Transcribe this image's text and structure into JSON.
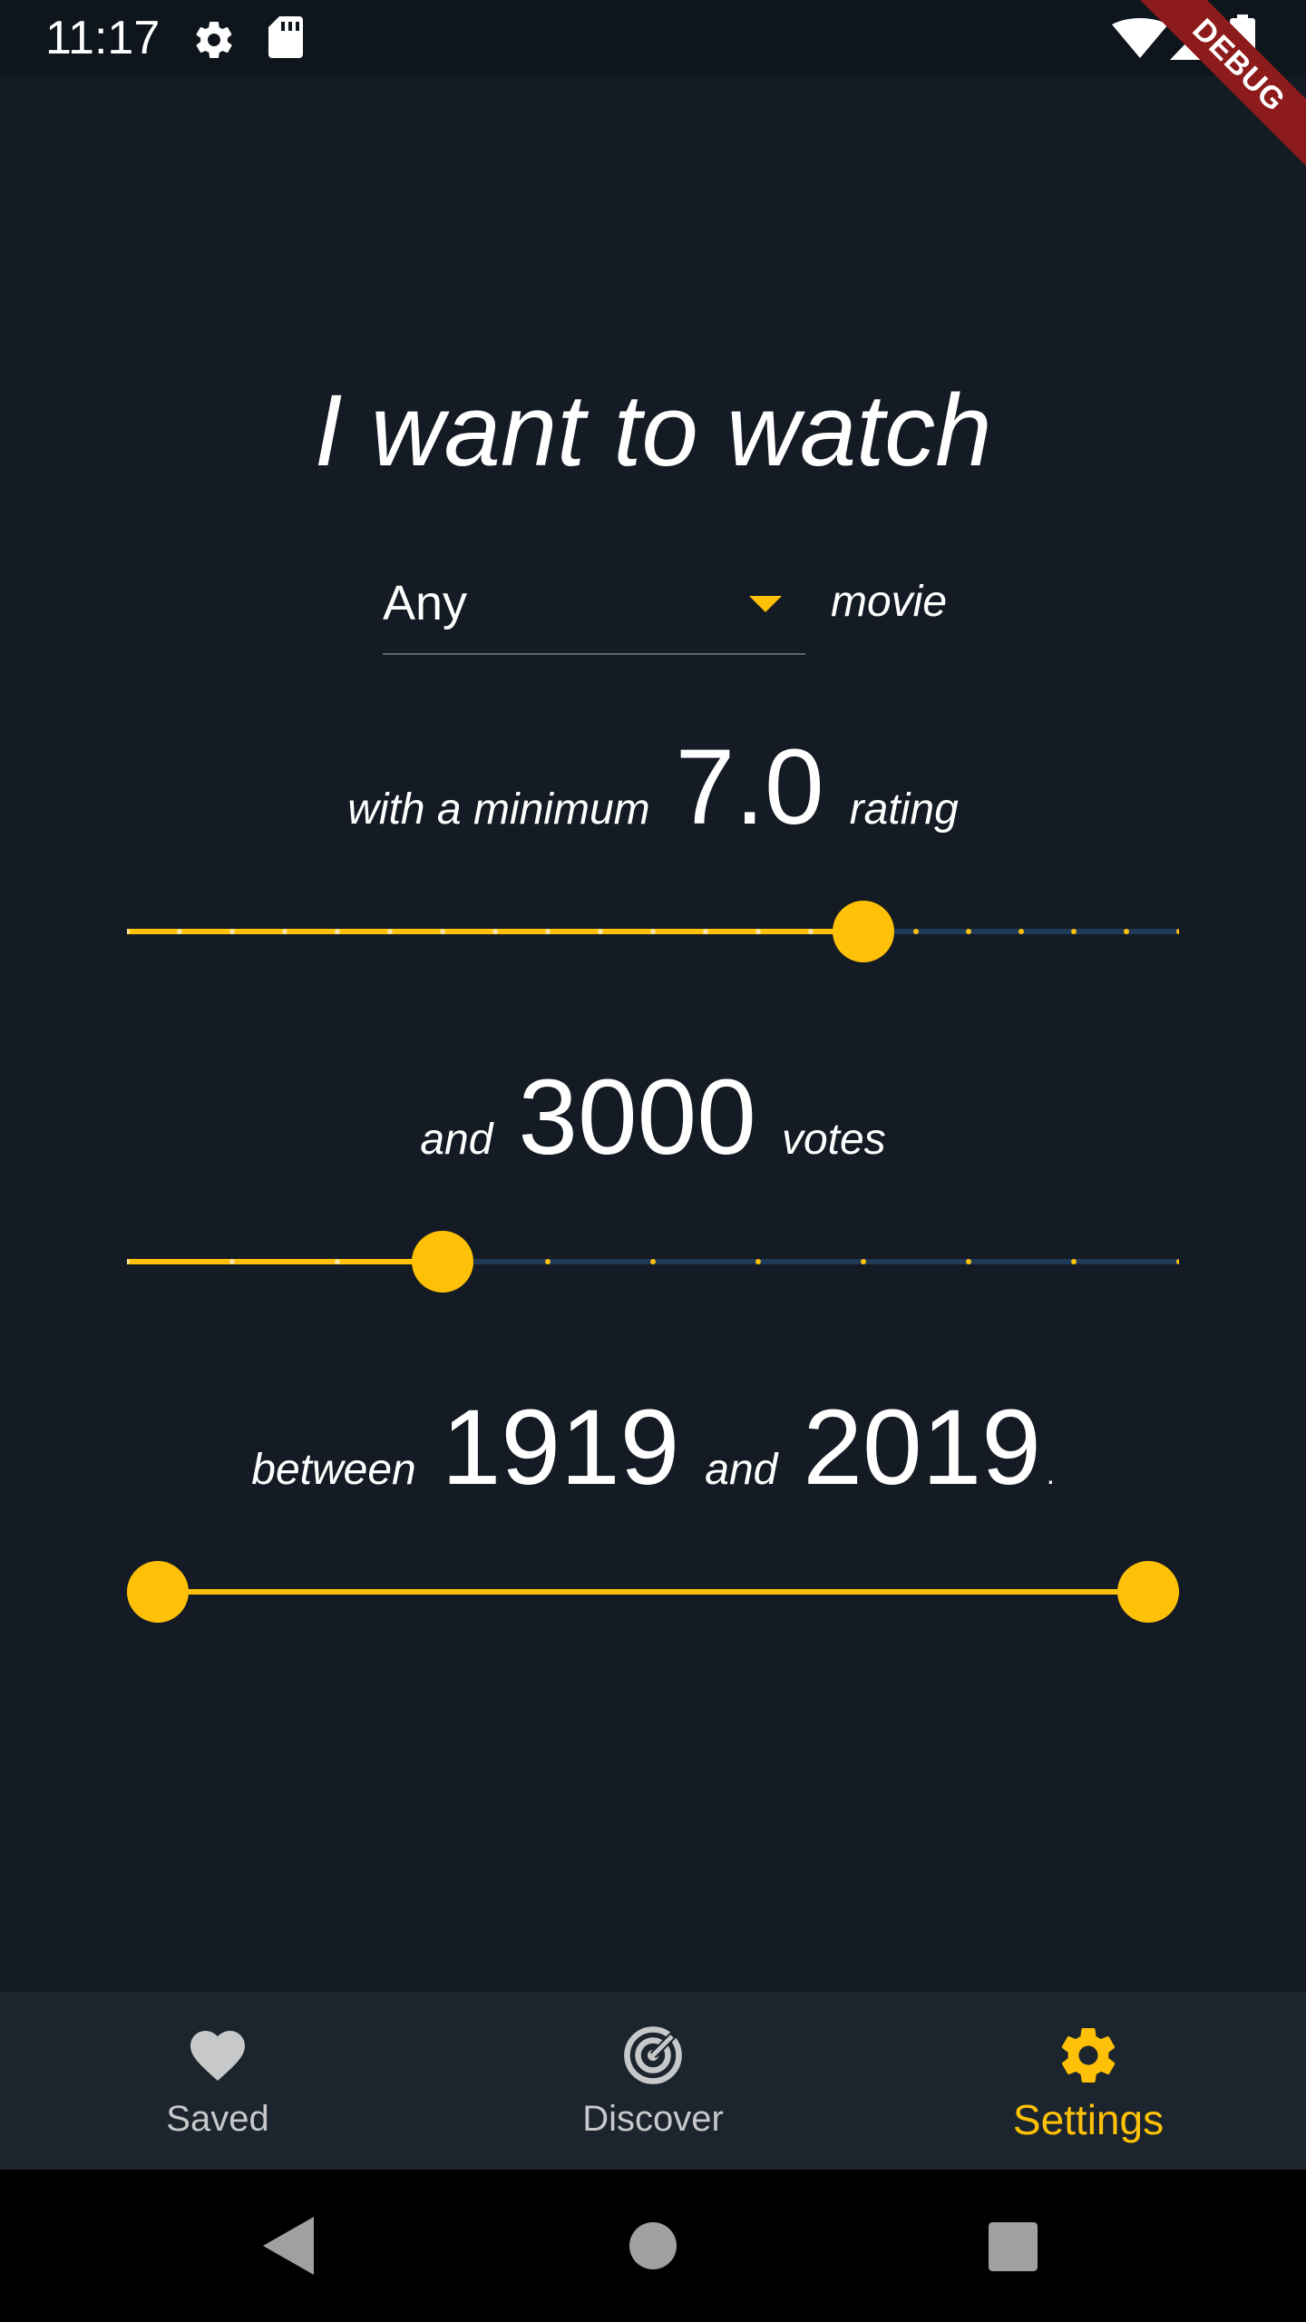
{
  "status_bar": {
    "time": "11:17",
    "icons": [
      "gear-icon",
      "sd-card-icon",
      "wifi-icon",
      "signal-icon",
      "battery-icon"
    ],
    "debug_banner": "DEBUG"
  },
  "headline": "I want to watch",
  "type_select": {
    "value": "Any",
    "suffix": "movie"
  },
  "rating": {
    "prefix": "with a minimum",
    "value": "7.0",
    "suffix": "rating",
    "slider_fraction": 0.7,
    "divisions": 20
  },
  "votes": {
    "prefix": "and",
    "value": "3000",
    "suffix": "votes",
    "slider_fraction": 0.3,
    "divisions": 10
  },
  "years": {
    "prefix": "between",
    "start": "1919",
    "middle": "and",
    "end": "2019",
    "period": ".",
    "range_start_fraction": 0.0,
    "range_end_fraction": 1.0
  },
  "bottom_nav": {
    "items": [
      {
        "label": "Saved",
        "icon": "heart-icon",
        "active": false
      },
      {
        "label": "Discover",
        "icon": "radar-icon",
        "active": false
      },
      {
        "label": "Settings",
        "icon": "gear-icon",
        "active": true
      }
    ]
  },
  "colors": {
    "background": "#141b24",
    "accent": "#ffc107",
    "inactive_track": "#1f3a56",
    "nav_background": "#1c242e"
  }
}
